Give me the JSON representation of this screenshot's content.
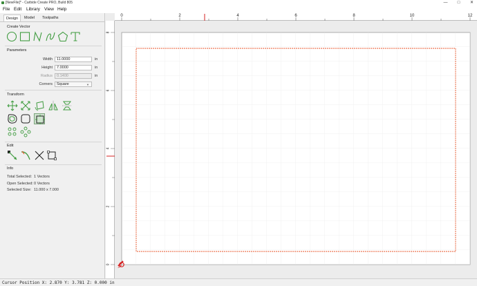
{
  "window": {
    "title": "[NewFile]* - Carbide Create PRO, Build 805",
    "controls": [
      "—",
      "□",
      "✕"
    ]
  },
  "menu": [
    "File",
    "Edit",
    "Library",
    "View",
    "Help"
  ],
  "tabs": [
    "Design",
    "Model",
    "Toolpaths"
  ],
  "sections": {
    "create_vector": "Create Vector",
    "parameters": "Parameters",
    "transform": "Transform",
    "edit": "Edit",
    "info": "Info"
  },
  "create_vector_tools": [
    "circle-icon",
    "rectangle-icon",
    "polyline-icon",
    "curve-icon",
    "polygon-icon",
    "text-icon"
  ],
  "parameters": {
    "width_label": "Width",
    "width_value": "11.0000",
    "height_label": "Height",
    "height_value": "7.0000",
    "radius_label": "Radius",
    "radius_value": "0.1400",
    "corners_label": "Corners",
    "corners_value": "Square",
    "unit": "in"
  },
  "info": {
    "total_selected_label": "Total Selected:",
    "total_selected_value": "1 Vectors",
    "open_selected_label": "Open Selected:",
    "open_selected_value": "0 Vectors",
    "selected_size_label": "Selected Size:",
    "selected_size_value": "11.000 x 7.000"
  },
  "ruler": {
    "x_ticks": [
      "0",
      "2",
      "4",
      "6",
      "8",
      "10",
      "12"
    ],
    "y_ticks": [
      "0",
      "2",
      "4",
      "6",
      "8"
    ]
  },
  "colors": {
    "accent_green": "#3f9b3f",
    "selection_orange": "#e8552a",
    "cursor_red": "#d62020"
  },
  "status": "Cursor Position X: 2.870 Y: 3.781 Z: 0.000 in"
}
